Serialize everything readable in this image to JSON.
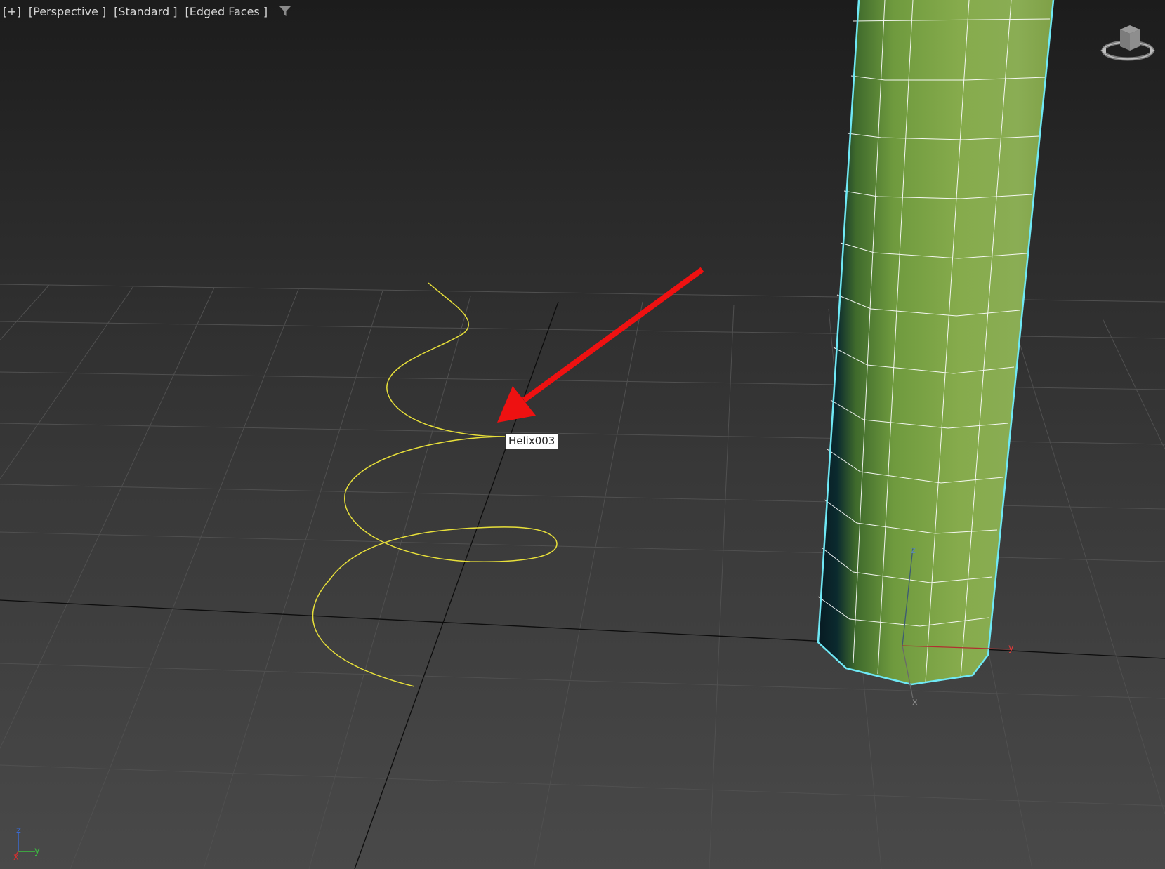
{
  "viewport": {
    "menu_label": "[+]",
    "view_label": "[Perspective ]",
    "shading_label": "[Standard ]",
    "display_label": "[Edged Faces ]",
    "filter_icon": "funnel-icon"
  },
  "tooltip": {
    "object_name": "Helix003"
  },
  "gizmo": {
    "z_label": "z",
    "y_label": "y",
    "x_label": "x"
  },
  "world_axis": {
    "z_label": "z",
    "y_label": "y",
    "x_label": "x"
  },
  "colors": {
    "helix": "#e8e03a",
    "cylinder": "#8aad4b",
    "selection": "#6fe8f5",
    "annotation_arrow": "#ee1111",
    "grid": "#505050"
  }
}
